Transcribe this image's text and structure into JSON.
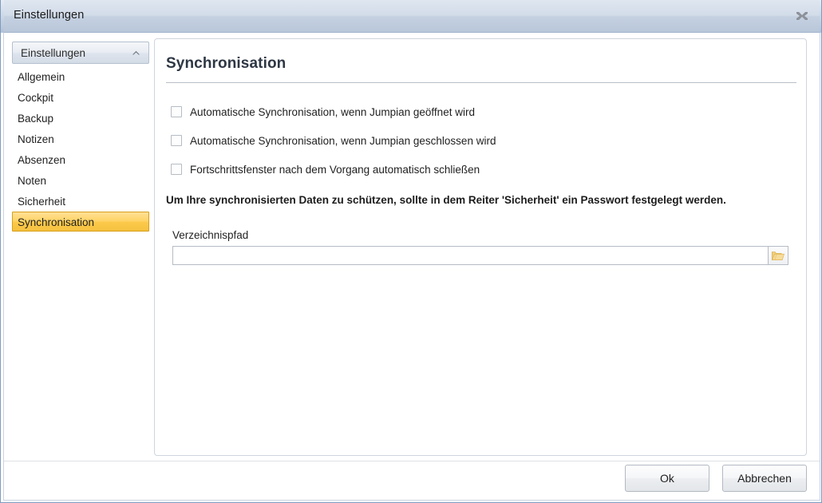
{
  "window": {
    "title": "Einstellungen",
    "close_icon": "close-icon"
  },
  "sidebar": {
    "header": {
      "label": "Einstellungen",
      "chevron_icon": "chevron-up-icon"
    },
    "items": [
      {
        "label": "Allgemein",
        "selected": false
      },
      {
        "label": "Cockpit",
        "selected": false
      },
      {
        "label": "Backup",
        "selected": false
      },
      {
        "label": "Notizen",
        "selected": false
      },
      {
        "label": "Absenzen",
        "selected": false
      },
      {
        "label": "Noten",
        "selected": false
      },
      {
        "label": "Sicherheit",
        "selected": false
      },
      {
        "label": "Synchronisation",
        "selected": true
      }
    ],
    "selected_bg": "#ffd468",
    "selected_border": "#d8a01c"
  },
  "content": {
    "title": "Synchronisation",
    "checkboxes": [
      {
        "label": "Automatische Synchronisation, wenn Jumpian geöffnet wird",
        "checked": false
      },
      {
        "label": "Automatische Synchronisation, wenn Jumpian geschlossen wird",
        "checked": false
      },
      {
        "label": "Fortschrittsfenster nach dem Vorgang automatisch schließen",
        "checked": false
      }
    ],
    "notice": "Um Ihre synchronisierten Daten zu schützen, sollte in dem Reiter 'Sicherheit' ein Passwort festgelegt werden.",
    "path_field": {
      "label": "Verzeichnispfad",
      "value": "",
      "placeholder": "",
      "browse_icon": "folder-icon"
    }
  },
  "footer": {
    "ok_label": "Ok",
    "cancel_label": "Abbrechen"
  }
}
